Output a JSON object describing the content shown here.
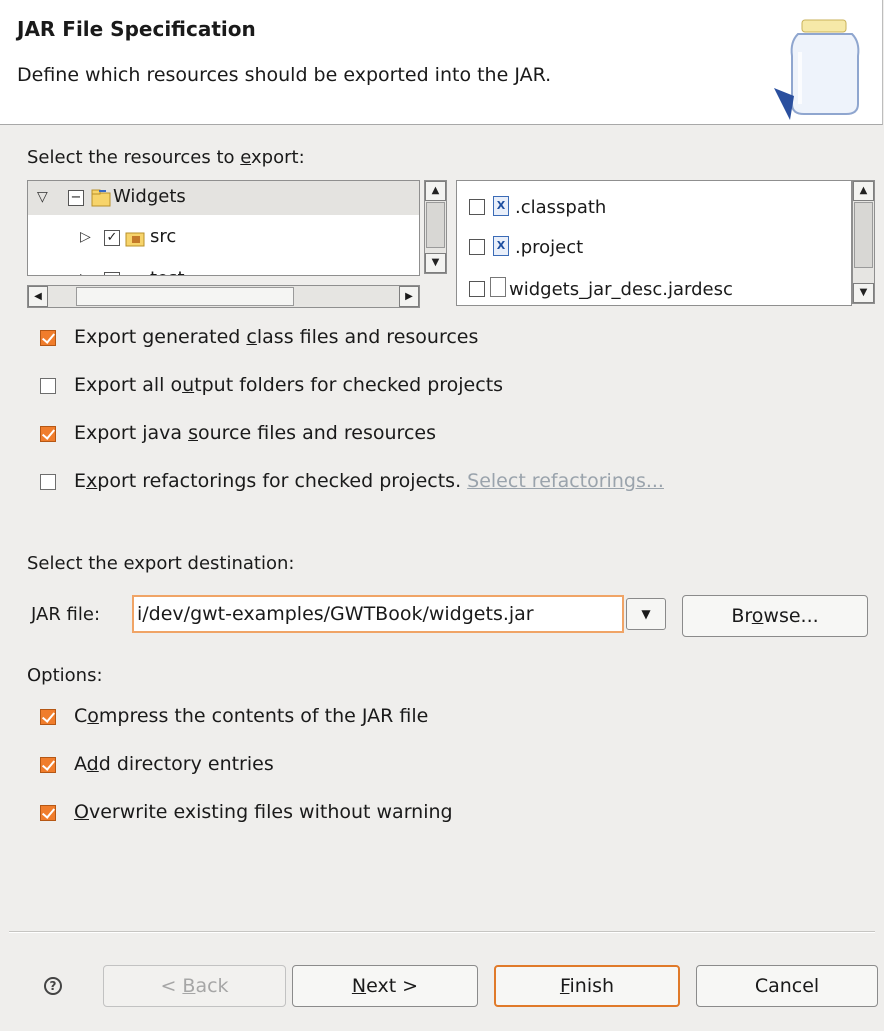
{
  "header": {
    "title": "JAR File Specification",
    "subtitle": "Define which resources should be exported into the JAR."
  },
  "resources": {
    "label": "Select the resources to export:",
    "tree": [
      {
        "label": "Widgets",
        "state": "partial",
        "expanded": true
      },
      {
        "label": "src",
        "state": "checked",
        "expanded": false
      },
      {
        "label": "test",
        "state": "unchecked",
        "expanded": false
      }
    ],
    "files": [
      {
        "label": ".classpath",
        "checked": false,
        "icon": "xml-file-icon"
      },
      {
        "label": ".project",
        "checked": false,
        "icon": "xml-file-icon"
      },
      {
        "label": "widgets_jar_desc.jardesc",
        "checked": false,
        "icon": "jardesc-file-icon"
      }
    ]
  },
  "options_top": [
    {
      "pre": "Export generated ",
      "key": "c",
      "post": "lass files and resources",
      "checked": true
    },
    {
      "pre": "Export all o",
      "key": "u",
      "post": "tput folders for checked projects",
      "checked": false
    },
    {
      "pre": "Export java ",
      "key": "s",
      "post": "ource files and resources",
      "checked": true
    },
    {
      "pre": "E",
      "key": "x",
      "post": "port refactorings for checked projects.",
      "checked": false
    }
  ],
  "select_refactorings_link": "Select refactorings...",
  "destination": {
    "label": "Select the export destination:",
    "jar_label_key": "J",
    "jar_label_rest": "AR file:",
    "jar_value": "i/dev/gwt-examples/GWTBook/widgets.jar",
    "browse_pre": "Br",
    "browse_key": "o",
    "browse_post": "wse..."
  },
  "options_label": "Options:",
  "options_bottom": [
    {
      "pre": "C",
      "key": "o",
      "post": "mpress the contents of the JAR file",
      "checked": true
    },
    {
      "pre": "A",
      "key": "d",
      "post": "d directory entries",
      "checked": true
    },
    {
      "pre": "",
      "key": "O",
      "post": "verwrite existing files without warning",
      "checked": true
    }
  ],
  "footer": {
    "back_pre": "< ",
    "back_key": "B",
    "back_post": "ack",
    "next_key": "N",
    "next_post": "ext >",
    "finish_key": "F",
    "finish_post": "inish",
    "cancel": "Cancel"
  },
  "colors": {
    "accent": "#f07d2c",
    "header_bg": "#ffffff",
    "body_bg": "#efeeec"
  }
}
